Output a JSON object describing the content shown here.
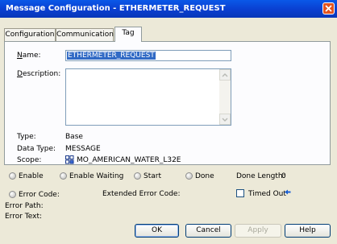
{
  "window": {
    "title": "Message Configuration - ETHERMETER_REQUEST"
  },
  "tabs": [
    {
      "label": "Configuration"
    },
    {
      "label": "Communication"
    },
    {
      "label": "Tag"
    }
  ],
  "tag_tab": {
    "name_label": "Name:",
    "name_value": "ETHERMETER_REQUEST",
    "description_label": "Description:",
    "description_value": "",
    "type_label": "Type:",
    "type_value": "Base",
    "data_type_label": "Data Type:",
    "data_type_value": "MESSAGE",
    "scope_label": "Scope:",
    "scope_value": "MO_AMERICAN_WATER_L32E"
  },
  "status": {
    "enable": "Enable",
    "enable_waiting": "Enable Waiting",
    "start": "Start",
    "done": "Done",
    "done_length_label": "Done Length:",
    "done_length_value": "0",
    "error_code": "Error Code:",
    "extended_error_code": "Extended Error Code:",
    "timed_out": "Timed Out",
    "error_path": "Error Path:",
    "error_text": "Error Text:"
  },
  "buttons": {
    "ok": "OK",
    "cancel": "Cancel",
    "apply": "Apply",
    "help": "Help"
  },
  "colors": {
    "title_bar": "#0a4be0",
    "selection": "#316ac5",
    "dialog_bg": "#ece9d8",
    "arrow": "#1a5fd4"
  }
}
